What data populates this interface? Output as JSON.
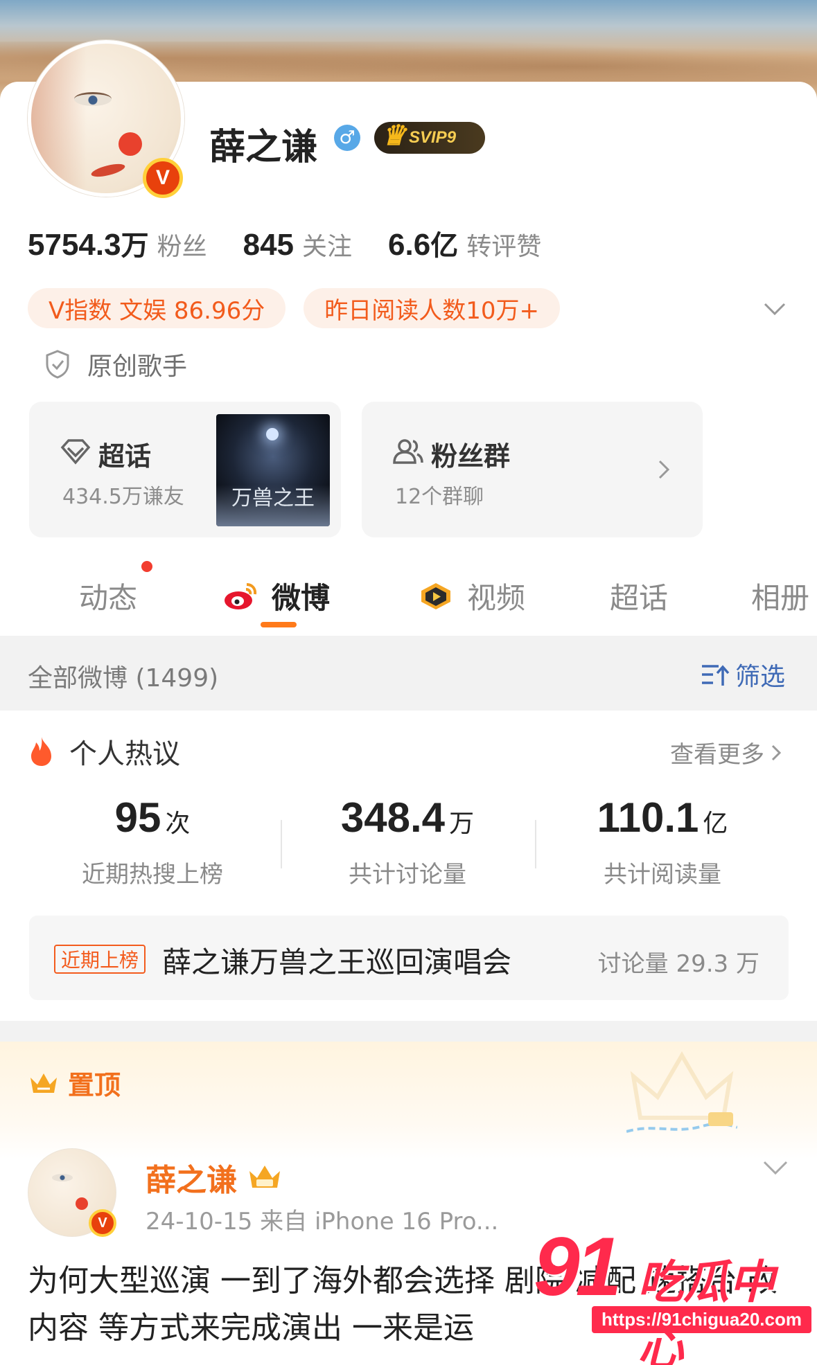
{
  "profile": {
    "name": "薛之谦",
    "gender_symbol": "♂",
    "svip_label": "SVIP9",
    "verified_badge": "V",
    "stats": [
      {
        "num": "5754.3",
        "unit": "万",
        "label": "粉丝"
      },
      {
        "num": "845",
        "unit": "",
        "label": "关注"
      },
      {
        "num": "6.6",
        "unit": "亿",
        "label": "转评赞"
      }
    ],
    "pills": [
      "V指数 文娱 86.96分",
      "昨日阅读人数10万+"
    ],
    "role": "原创歌手"
  },
  "tiles": {
    "supertopic": {
      "title": "超话",
      "sub": "434.5万谦友",
      "thumb_text": "万兽之王"
    },
    "fangroup": {
      "title": "粉丝群",
      "sub": "12个群聊"
    }
  },
  "tabs": [
    "动态",
    "微博",
    "视频",
    "超话",
    "相册"
  ],
  "filter": {
    "all_label": "全部微博 (1499)",
    "filter_label": "筛选"
  },
  "hot": {
    "title": "个人热议",
    "more": "查看更多",
    "metrics": [
      {
        "value": "95",
        "unit": "次",
        "label": "近期热搜上榜"
      },
      {
        "value": "348.4",
        "unit": "万",
        "label": "共计讨论量"
      },
      {
        "value": "110.1",
        "unit": "亿",
        "label": "共计阅读量"
      }
    ],
    "trend": {
      "tag": "近期上榜",
      "topic": "薛之谦万兽之王巡回演唱会",
      "count": "讨论量 29.3 万"
    }
  },
  "post": {
    "pinned_label": "置顶",
    "author": "薛之谦",
    "meta": "24-10-15  来自 iPhone 16 Pro...",
    "text": "为何大型巡演 一到了海外都会选择 剧院 减配 速搭台 改内容 等方式来完成演出 一来是运"
  },
  "watermark": {
    "big": "91",
    "cn": "吃瓜中心",
    "url": "https://91chigua20.com"
  },
  "colors": {
    "accent": "#f2701d",
    "link": "#3f6ab6",
    "badge_red": "#e8410c"
  }
}
